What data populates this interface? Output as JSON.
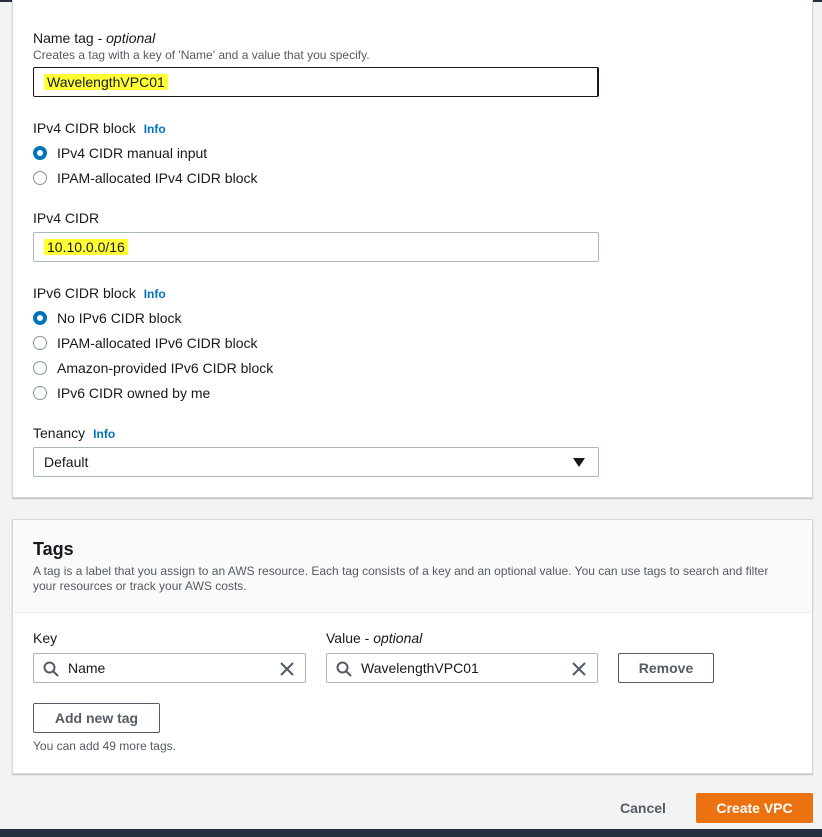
{
  "name_tag": {
    "label": "Name tag - ",
    "optional": "optional",
    "description": "Creates a tag with a key of 'Name' and a value that you specify.",
    "value": "WavelengthVPC01"
  },
  "ipv4_block": {
    "label": "IPv4 CIDR block",
    "info": "Info",
    "options": [
      "IPv4 CIDR manual input",
      "IPAM-allocated IPv4 CIDR block"
    ],
    "selected": 0
  },
  "ipv4_cidr": {
    "label": "IPv4 CIDR",
    "value": "10.10.0.0/16"
  },
  "ipv6_block": {
    "label": "IPv6 CIDR block",
    "info": "Info",
    "options": [
      "No IPv6 CIDR block",
      "IPAM-allocated IPv6 CIDR block",
      "Amazon-provided IPv6 CIDR block",
      "IPv6 CIDR owned by me"
    ],
    "selected": 0
  },
  "tenancy": {
    "label": "Tenancy",
    "info": "Info",
    "value": "Default"
  },
  "tags": {
    "title": "Tags",
    "description_line1": "A tag is a label that you assign to an AWS resource. Each tag consists of a key and an optional value. You can use tags to search and filter",
    "description_line2": "your resources or track your AWS costs.",
    "key_label": "Key",
    "value_label": "Value - ",
    "value_optional": "optional",
    "rows": [
      {
        "key": "Name",
        "value": "WavelengthVPC01"
      }
    ],
    "remove_label": "Remove",
    "add_label": "Add new tag",
    "remaining_text": "You can add 49 more tags."
  },
  "footer": {
    "cancel_label": "Cancel",
    "create_label": "Create VPC"
  },
  "colors": {
    "primary": "#ec7211",
    "link": "#0073bb",
    "highlight": "#ffff33"
  }
}
